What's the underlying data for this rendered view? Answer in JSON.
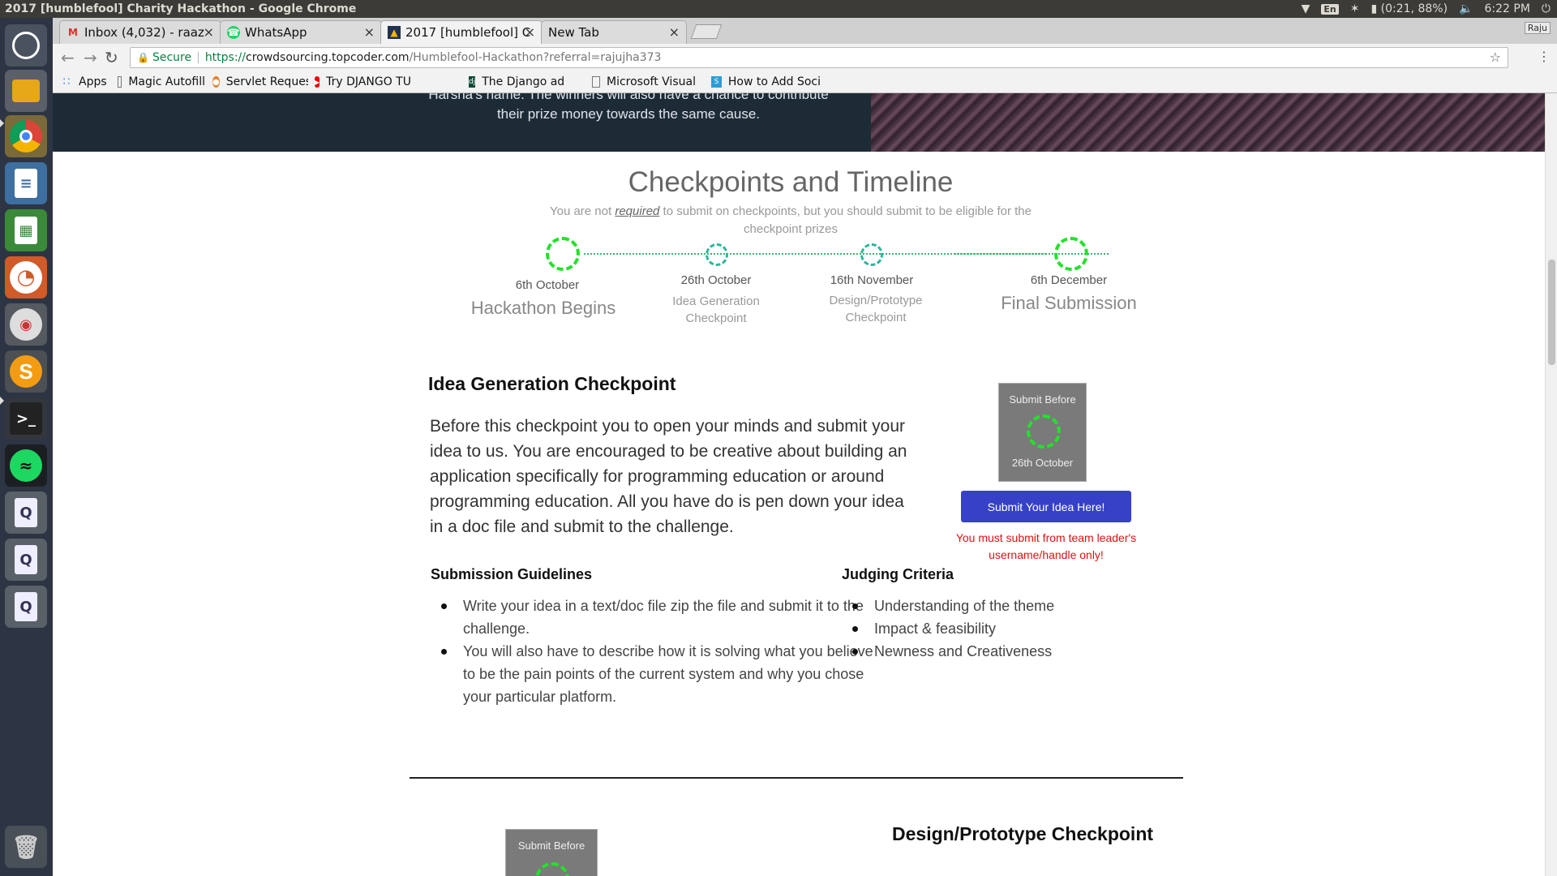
{
  "os": {
    "window_title": "2017 [humblefool] Charity Hackathon - Google Chrome",
    "lang_indicator": "En",
    "battery": "(0:21, 88%)",
    "clock": "6:22 PM"
  },
  "browser": {
    "tabs": [
      {
        "label": "Inbox (4,032) - raaz",
        "icon": "gmail-icon"
      },
      {
        "label": "WhatsApp",
        "icon": "whatsapp-icon"
      },
      {
        "label": "2017 [humblefool] C",
        "icon": "topcoder-icon"
      },
      {
        "label": "New Tab",
        "icon": ""
      }
    ],
    "profile": "Raju",
    "secure_label": "Secure",
    "url_scheme": "https://",
    "url_host": "crowdsourcing.topcoder.com",
    "url_path": "/Humblefool-Hackathon?referral=rajujha373",
    "bookmarks": [
      {
        "label": "Apps",
        "icon": "apps-grid-icon"
      },
      {
        "label": "Magic Autofill",
        "icon": "page-icon"
      },
      {
        "label": "Servlet Request",
        "icon": "servlet-icon"
      },
      {
        "label": "Try DJANGO TUT",
        "icon": "youtube-icon"
      },
      {
        "label": "The Django adm",
        "icon": "django-icon"
      },
      {
        "label": "Microsoft Visual",
        "icon": "page-icon"
      },
      {
        "label": "How to Add Soci",
        "icon": "s-icon"
      }
    ]
  },
  "page": {
    "hero_text_line1": "Harsha's name. The winners will also have a chance to contribute",
    "hero_text_line2": "their prize money towards the same cause.",
    "section_title": "Checkpoints and Timeline",
    "section_sub_pre": "You are not ",
    "section_sub_em": "required",
    "section_sub_post": " to submit on checkpoints, but you should submit to be eligible for the checkpoint prizes",
    "timeline": [
      {
        "date": "6th October",
        "name": "Hackathon Begins"
      },
      {
        "date": "26th October",
        "name": "Idea Generation Checkpoint"
      },
      {
        "date": "16th November",
        "name": "Design/Prototype Checkpoint"
      },
      {
        "date": "6th December",
        "name": "Final Submission"
      }
    ],
    "checkpoint": {
      "title": "Idea Generation Checkpoint",
      "body": "Before this checkpoint you to open your minds and submit your idea to us. You are encouraged to be creative about building an application specifically for programming education or around programming education. All you have do is pen down your idea in a doc file and submit to the challenge.",
      "card_label": "Submit Before",
      "card_date": "26th October",
      "button": "Submit Your Idea Here!",
      "warning": "You must submit from team leader's username/handle only!",
      "guidelines_title": "Submission Guidelines",
      "guidelines": [
        "Write your idea in a text/doc file zip the file and submit it to the challenge.",
        "You will also have to describe how it is solving what you believe to be the pain points of the current system and why you chose your particular platform."
      ],
      "criteria_title": "Judging Criteria",
      "criteria": [
        "Understanding of the theme",
        "Impact & feasibility",
        "Newness and Creativeness"
      ]
    },
    "next_card_label": "Submit Before",
    "next_title": "Design/Prototype Checkpoint"
  }
}
